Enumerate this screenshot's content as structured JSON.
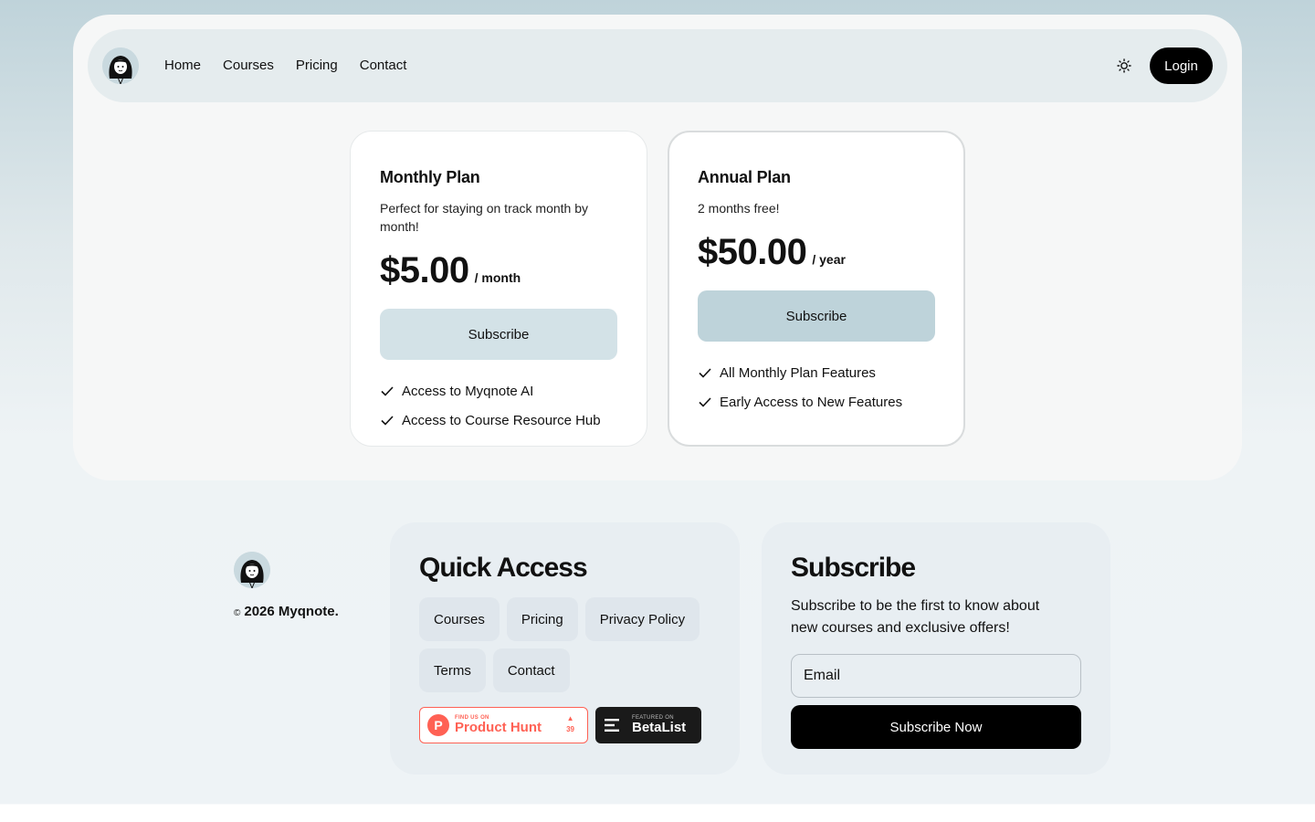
{
  "nav": {
    "links": [
      "Home",
      "Courses",
      "Pricing",
      "Contact"
    ],
    "login": "Login"
  },
  "plans": [
    {
      "title": "Monthly Plan",
      "description": "Perfect for staying on track month by month!",
      "price": "$5.00",
      "period": "/ month",
      "button": "Subscribe",
      "features": [
        "Access to Myqnote AI",
        "Access to Course Resource Hub"
      ]
    },
    {
      "title": "Annual Plan",
      "description": "2 months free!",
      "price": "$50.00",
      "period": "/ year",
      "button": "Subscribe",
      "features": [
        "All Monthly Plan Features",
        "Early Access to New Features"
      ]
    }
  ],
  "footer": {
    "copyright_symbol": "©",
    "copyright": "2026 Myqnote.",
    "quick_access": {
      "title": "Quick Access",
      "links": [
        "Courses",
        "Pricing",
        "Privacy Policy",
        "Terms",
        "Contact"
      ]
    },
    "badges": {
      "product_hunt": {
        "small": "FIND US ON",
        "big": "Product Hunt",
        "votes": "39"
      },
      "betalist": {
        "small": "FEATURED ON",
        "big": "BetaList"
      }
    },
    "subscribe": {
      "title": "Subscribe",
      "description": "Subscribe to be the first to know about new courses and exclusive offers!",
      "email_placeholder": "Email",
      "button": "Subscribe Now"
    }
  },
  "colors": {
    "accent_black": "#000000",
    "monthly_button": "#d3e2e7",
    "annual_button": "#bed3da",
    "product_hunt": "#ff6154"
  },
  "icons": [
    "avatar-logo-icon",
    "sun-icon",
    "check-icon",
    "product-hunt-icon",
    "betalist-icon"
  ]
}
